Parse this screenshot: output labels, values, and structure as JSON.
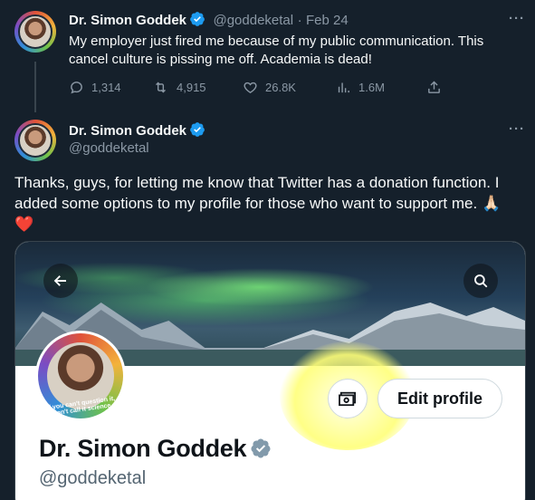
{
  "tweet1": {
    "name": "Dr. Simon Goddek",
    "handle": "@goddeketal",
    "separator": "·",
    "date": "Feb 24",
    "more": "···",
    "text": "My employer just fired me because of my public communication. This cancel culture is pissing me off. Academia is dead!",
    "replies": "1,314",
    "retweets": "4,915",
    "likes": "26.8K",
    "views": "1.6M"
  },
  "tweet2": {
    "name": "Dr. Simon Goddek",
    "handle": "@goddeketal",
    "more": "···",
    "text": "Thanks, guys, for letting me know that Twitter has a donation function. I added some options to my profile for those who want to support me. 🙏🏻",
    "heart": "❤️"
  },
  "embedded_profile": {
    "name": "Dr. Simon Goddek",
    "handle": "@goddeketal",
    "edit_button": "Edit profile",
    "avatar_caption": "If you can't question it, don't call it science"
  },
  "colors": {
    "background": "#15202b",
    "verified": "#1d9bf0",
    "muted": "#8b98a5",
    "highlight": "#ffff78"
  }
}
